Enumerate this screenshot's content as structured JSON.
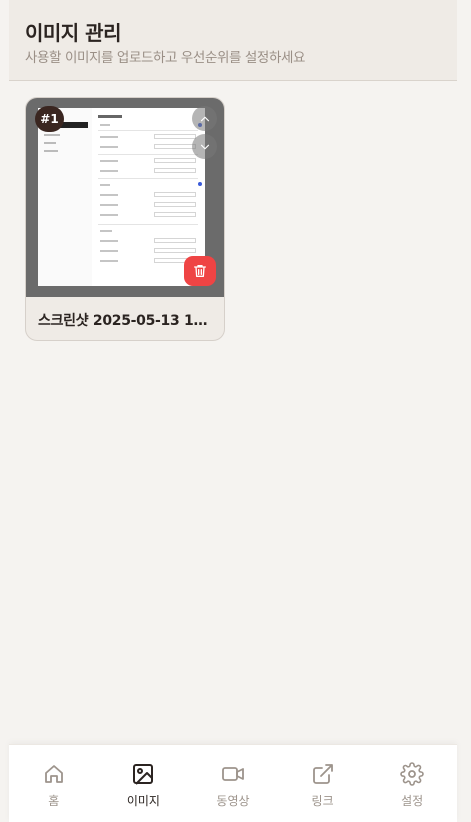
{
  "header": {
    "title": "이미지 관리",
    "subtitle": "사용할 이미지를 업로드하고 우선순위를 설정하세요"
  },
  "images": [
    {
      "rank": "#1",
      "name": "스크린샷 2025-05-13 114…",
      "thumbnail": "screenshot-thumbnail"
    }
  ],
  "nav": {
    "items": [
      {
        "label": "홈",
        "icon": "home-icon",
        "active": false
      },
      {
        "label": "이미지",
        "icon": "image-icon",
        "active": true
      },
      {
        "label": "동영상",
        "icon": "video-icon",
        "active": false
      },
      {
        "label": "링크",
        "icon": "external-link-icon",
        "active": false
      },
      {
        "label": "설정",
        "icon": "gear-icon",
        "active": false
      }
    ]
  },
  "colors": {
    "background": "#f5f3f0",
    "header_bg": "#efebe6",
    "badge_bg": "#3a2620",
    "delete_red": "#ef4444",
    "active_text": "#2b2421",
    "inactive_text": "#9d948c"
  }
}
